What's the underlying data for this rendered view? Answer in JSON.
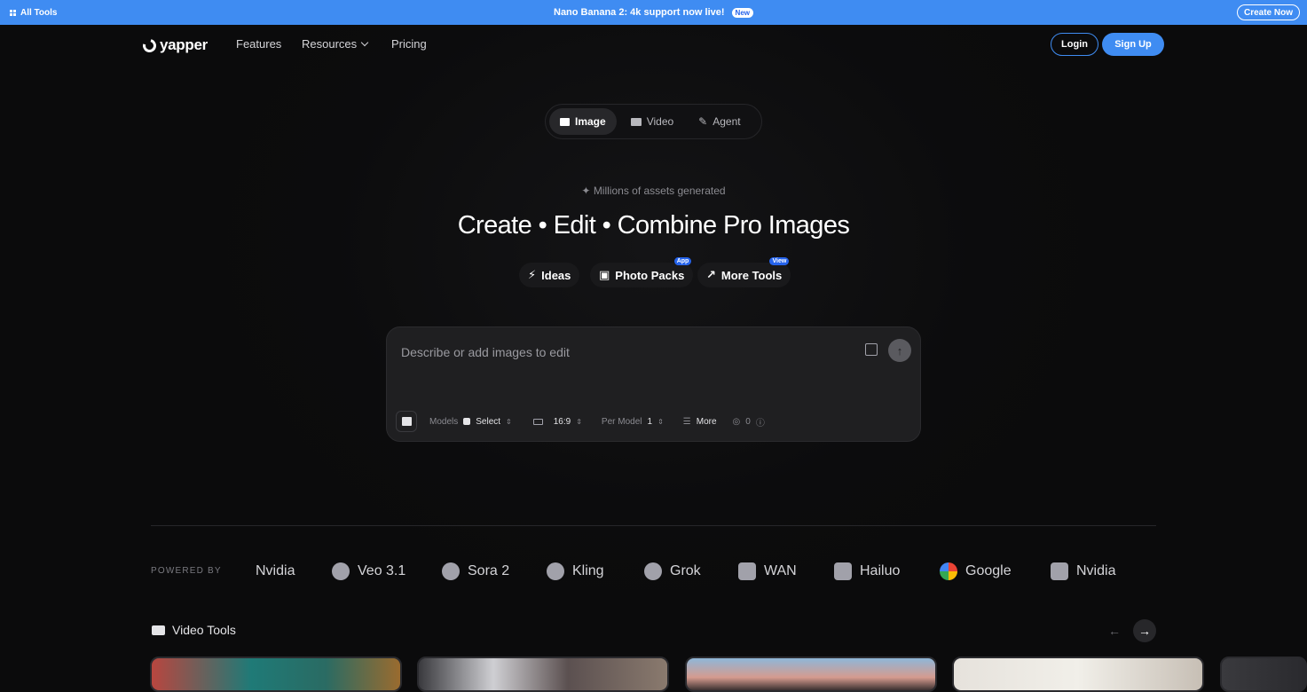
{
  "topbar": {
    "all_tools": "All Tools",
    "announcement": "Nano Banana 2: 4k support now live!",
    "new_badge": "New",
    "create_now": "Create Now"
  },
  "nav": {
    "logo": "yapper",
    "features": "Features",
    "resources": "Resources",
    "pricing": "Pricing",
    "login": "Login",
    "signup": "Sign Up"
  },
  "modes": [
    {
      "label": "Image",
      "icon": "image-icon",
      "active": true
    },
    {
      "label": "Video",
      "icon": "video-icon",
      "active": false
    },
    {
      "label": "Agent",
      "icon": "agent-icon",
      "active": false
    }
  ],
  "hero": {
    "subtitle": "Millions of assets generated",
    "headline": "Create • Edit • Combine Pro Images"
  },
  "chips": [
    {
      "label": "Ideas",
      "icon": "bolt-icon",
      "tag": ""
    },
    {
      "label": "Photo Packs",
      "icon": "photo-packs-icon",
      "tag": "App"
    },
    {
      "label": "More Tools",
      "icon": "arrow-up-right-icon",
      "tag": "View"
    }
  ],
  "prompt": {
    "placeholder": "Describe or add images to edit",
    "models_label": "Models",
    "models_value": "Select",
    "aspect_value": "16:9",
    "per_model_label": "Per Model",
    "per_model_value": "1",
    "more_label": "More",
    "credits_value": "0"
  },
  "powered_by": {
    "label": "POWERED BY",
    "brands": [
      "Nvidia",
      "Veo 3.1",
      "Sora 2",
      "Kling",
      "Grok",
      "WAN",
      "Hailuo",
      "Google",
      "Nvidia"
    ]
  },
  "video_tools": {
    "title": "Video Tools"
  },
  "colors": {
    "accent": "#3f8cf2",
    "background": "#0b0b0c",
    "panel": "#1f1f21"
  }
}
